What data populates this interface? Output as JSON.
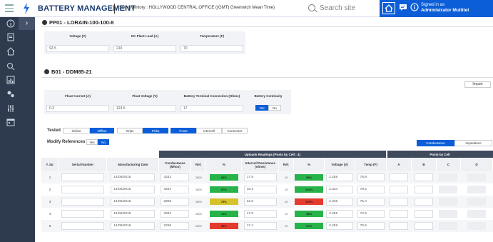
{
  "header": {
    "title": "BATTERY MANAGEMENT",
    "site_inventory": "Site Inventory : HOLLYWOOD CENTRAL OFFICE ((GMT) Greenwich Mean Time)",
    "search_placeholder": "Search site",
    "signed_in_label": "Signed in as",
    "user": "Administrator Multitel"
  },
  "powerplant": {
    "title": "PP01 - LORAIN-100-100-8",
    "columns": [
      "Voltage (V)",
      "DC Plant Load (A)",
      "Temperature (F)"
    ],
    "values": [
      "92.5",
      "210",
      "70"
    ]
  },
  "battery": {
    "title": "B01 - DDM85-21",
    "import_label": "Import",
    "columns": [
      "Float Current (A)",
      "Float Voltage (V)",
      "Battery Terminal Connection (Ohms)",
      "Battery Continuity"
    ],
    "values": [
      "0.3",
      "123.5",
      "17"
    ],
    "continuity_yes": "Yes",
    "continuity_no": "No"
  },
  "tested": {
    "label": "Tested",
    "options": [
      "Online",
      "Offline",
      "Grips",
      "Picks",
      "Posts",
      "Intercell",
      "Connector"
    ],
    "active": [
      "Offline",
      "Picks",
      "Posts"
    ]
  },
  "modify": {
    "label": "Modify References",
    "yes": "Yes",
    "no": "No"
  },
  "view_toggle": {
    "conductance": "Conductance",
    "impedance": "Impedance"
  },
  "table": {
    "group_uploads": "Uploads Readings (Posts by Cell : 4)",
    "group_posts": "Posts by Cell",
    "headers": [
      "# Jar",
      "Serial Number",
      "Manufacturing Date",
      "Conductance (Mhos)",
      "Ref.",
      "%",
      "Intercell Resistance (ohms)",
      "Ref.",
      "%",
      "Voltage (V)",
      "Temp (F)",
      "A",
      "B",
      "C",
      "D"
    ],
    "rows": [
      {
        "jar": "1",
        "date": "14/09/2015",
        "cond": "3331",
        "ref1": "2800",
        "pct1": "63%",
        "c1": "#27b34a",
        "ir": "17.9",
        "ref2": "19",
        "pct2": "99%",
        "c2": "#27b34a",
        "v": "2.259",
        "t": "75.8"
      },
      {
        "jar": "2",
        "date": "14/05/2015",
        "cond": "3404",
        "ref1": "2800",
        "pct1": "67%",
        "c1": "#27b34a",
        "ir": "18.2",
        "ref2": "19",
        "pct2": "101%",
        "c2": "#27b34a",
        "v": "2.334",
        "t": "78.2"
      },
      {
        "jar": "3",
        "date": "14/05/2016",
        "cond": "2806",
        "ref1": "2800",
        "pct1": "75%",
        "c1": "#d6c32a",
        "ir": "22.5",
        "ref2": "19",
        "pct2": "105%",
        "c2": "#e53b2e",
        "v": "2.339",
        "t": "75.4"
      },
      {
        "jar": "4",
        "date": "14/09/2015",
        "cond": "3094",
        "ref1": "2800",
        "pct1": "74%",
        "c1": "#27b34a",
        "ir": "17.6",
        "ref2": "19",
        "pct2": "98%",
        "c2": "#27b34a",
        "v": "2.265",
        "t": "74.6"
      },
      {
        "jar": "5",
        "date": "14/09/2016",
        "cond": "2256",
        "ref1": "2800",
        "pct1": "56%",
        "c1": "#e53b2e",
        "ir": "17.4",
        "ref2": "19",
        "pct2": "97%",
        "c2": "#27b34a",
        "v": "2.259",
        "t": "76.5"
      }
    ]
  }
}
